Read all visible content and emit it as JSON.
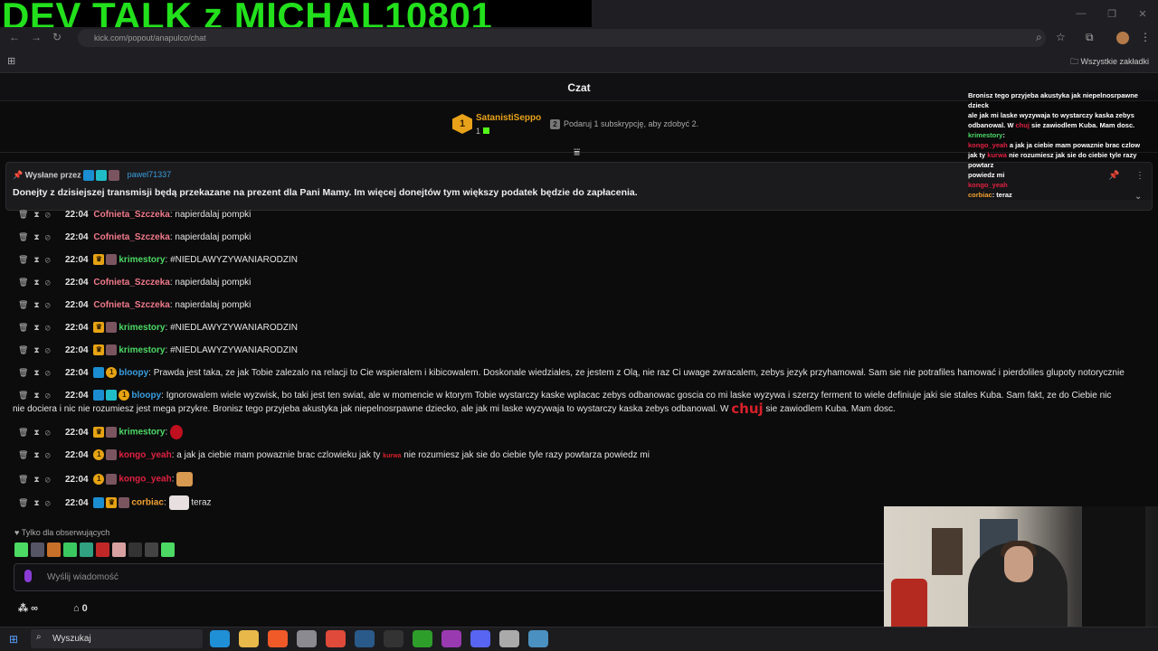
{
  "overlay": {
    "title": "DEV TALK  z MICHAL10801"
  },
  "browser": {
    "url": "kick.com/popout/anapulco/chat",
    "bookmarks_all": "Wszystkie zakładki",
    "nav_icons": [
      "back-icon",
      "forward-icon",
      "reload-icon"
    ]
  },
  "chat": {
    "title": "Czat",
    "top_sub": {
      "rank": "1",
      "name": "SatanistiSeppo",
      "count": "1",
      "gift_text": "Podaruj 1 subskrypcję, aby zdobyć 2."
    },
    "pinned": {
      "label": "Wysłane przez",
      "user": "pawel71337",
      "text": "Donejty z dzisiejszej transmisji będą przekazane na prezent dla Pani Mamy. Im więcej donejtów tym większy podatek będzie do zapłacenia."
    },
    "messages": [
      {
        "time": "22:04",
        "user": "Cofnieta_Szczeka",
        "text": "napierdalaj pompki"
      },
      {
        "time": "22:04",
        "user": "Cofnieta_Szczeka",
        "text": "napierdalaj pompki"
      },
      {
        "time": "22:04",
        "user": "krimestory",
        "text": "#NIEDLAWYZYWANIARODZIN"
      },
      {
        "time": "22:04",
        "user": "Cofnieta_Szczeka",
        "text": "napierdalaj pompki"
      },
      {
        "time": "22:04",
        "user": "Cofnieta_Szczeka",
        "text": "napierdalaj pompki"
      },
      {
        "time": "22:04",
        "user": "krimestory",
        "text": "#NIEDLAWYZYWANIARODZIN"
      },
      {
        "time": "22:04",
        "user": "krimestory",
        "text": "#NIEDLAWYZYWANIARODZIN"
      },
      {
        "time": "22:04",
        "user": "bloopy",
        "text": "Prawda jest taka, ze jak Tobie zalezalo na relacji to Cie wspieralem i kibicowalem. Doskonale wiedziales, ze jestem z Olą, nie raz Ci uwage zwracalem, zebys jezyk przyhamował. Sam sie nie potrafiles hamować i pierdoliles glupoty notorycznie"
      },
      {
        "time": "22:04",
        "user": "bloopy",
        "text_a": "Ignorowalem wiele wyzwisk, bo taki jest ten swiat, ale w momencie w ktorym Tobie wystarczy kaske wplacac zebys odbanowac goscia co mi laske wyzywa i szerzy ferment to wiele definiuje jaki sie stales Kuba. Sam fakt, ze do Ciebie nic nie dociera i nic nie rozumiesz jest mega przykre. Bronisz tego przyjeba akustyka jak niepelnosrpawne dziecko, ale jak mi laske wyzywaja to wystarczy kaska zebys odbanowal. W",
        "emote": "chuj",
        "text_b": "sie zawiodlem Kuba. Mam dosc."
      },
      {
        "time": "22:04",
        "user": "krimestory",
        "text": ""
      },
      {
        "time": "22:04",
        "user": "kongo_yeah",
        "text_a": "a jak ja ciebie mam powaznie brac czlowieku jak ty",
        "emote": "kurwa",
        "text_b": "nie rozumiesz jak sie do ciebie tyle razy powtarza powiedz mi"
      },
      {
        "time": "22:04",
        "user": "kongo_yeah",
        "text": ""
      },
      {
        "time": "22:04",
        "user": "corbiac",
        "text": "teraz"
      }
    ],
    "followers_only": "Tylko dla obserwujących",
    "input_placeholder": "Wyślij wiadomość",
    "stats": {
      "infinity": "∞",
      "count": "0"
    }
  },
  "stream_overlay_chat": {
    "lines": [
      "Bronisz tego przyjeba akustyka jak niepelnosrpawne dzieck",
      "ale jak mi laske wyzywaja to wystarczy kaska zebys",
      "odbanowal. W",
      "sie zawiodlem Kuba. Mam dosc."
    ],
    "emote": "chuj",
    "user1": "krimestory",
    "user2": "kongo_yeah",
    "line2": "a jak ja ciebie mam powaznie brac czlow",
    "line3a": "jak ty",
    "line3_emote": "kurwa",
    "line3b": "nie rozumiesz jak sie do ciebie tyle razy powtarz",
    "line4": "powiedz mi",
    "user3": "kongo_yeah",
    "user4": "corbiac",
    "last": "teraz"
  },
  "taskbar": {
    "search": "Wyszukaj"
  },
  "colors": {
    "kick_green": "#53fc18",
    "accent_gold": "#e8a21a"
  }
}
